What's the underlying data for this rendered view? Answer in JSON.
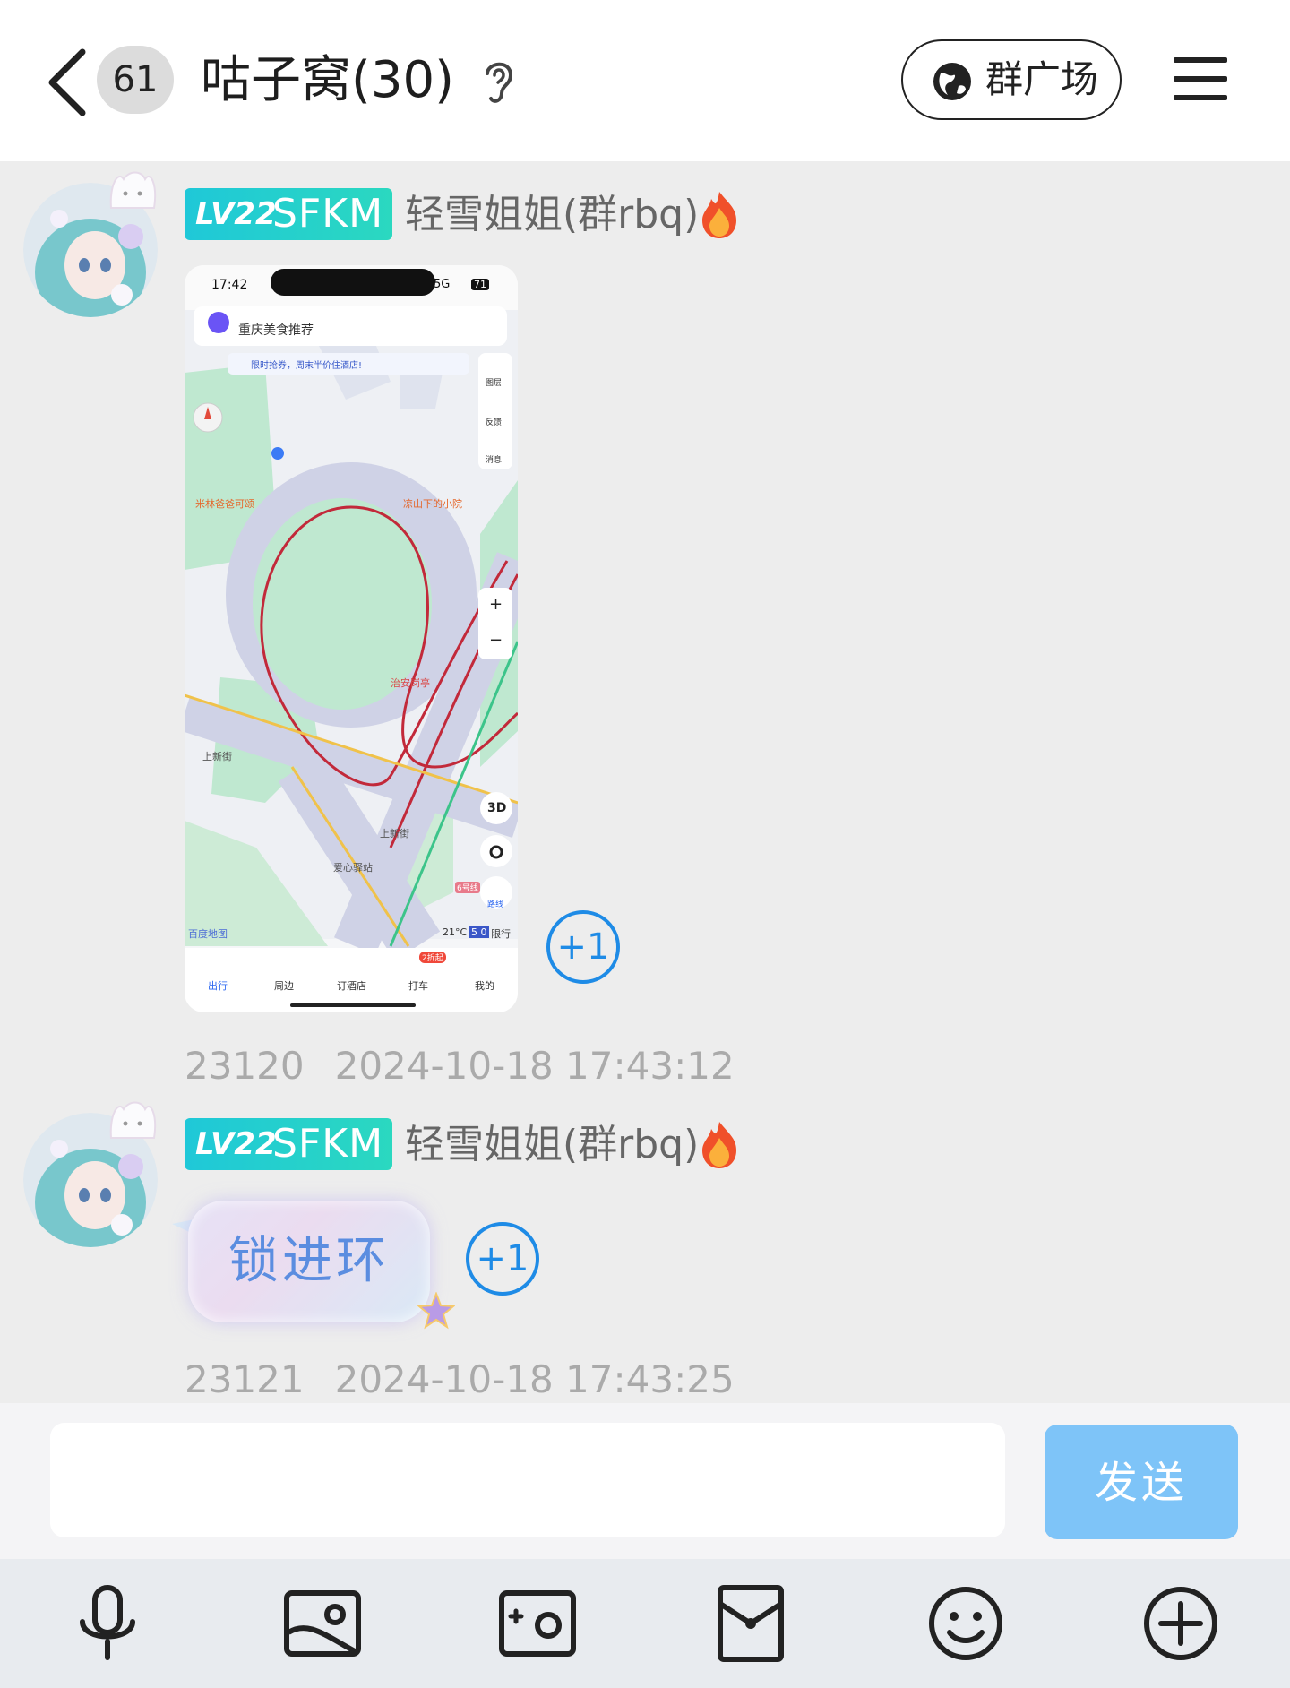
{
  "header": {
    "unread_count": "61",
    "title": "咕子窝(30)",
    "square_label": "群广场"
  },
  "messages": [
    {
      "level": "LV22",
      "badge": "SFKM",
      "sender": "轻雪姐姐(群rbq)",
      "plus_one": "+1",
      "msg_id": "23120",
      "time": "2024-10-18 17:43:12"
    },
    {
      "level": "LV22",
      "badge": "SFKM",
      "sender": "轻雪姐姐(群rbq)",
      "text": "锁进环",
      "plus_one": "+1",
      "msg_id": "23121",
      "time": "2024-10-18 17:43:25"
    }
  ],
  "screenshot": {
    "status_time": "17:42",
    "network": "5G",
    "battery": "71",
    "search_text": "重庆美食推荐",
    "promo_text": "限时抢券，周末半价住酒店!",
    "side_tools": [
      "图层",
      "反馈",
      "消息"
    ],
    "zoom_in": "+",
    "zoom_out": "−",
    "poi_1": "米林爸爸可颂",
    "poi_2": "凉山下的小院",
    "poi_3": "治安岗亭",
    "poi_4": "爱心驿站",
    "street_1": "上新街",
    "street_2": "上新街",
    "badge_3d": "3D",
    "route_label": "路线",
    "road_tag": "6号线",
    "weather": "21°C",
    "limit_num": "5 0",
    "limit_label": "限行",
    "map_brand": "百度地图",
    "taxi_badge": "2折起",
    "nav_tabs": [
      "出行",
      "周边",
      "订酒店",
      "打车",
      "我的"
    ]
  },
  "input": {
    "placeholder": "",
    "send_label": "发送"
  },
  "toolbar_icons": [
    "microphone-icon",
    "image-icon",
    "camera-icon",
    "red-packet-icon",
    "emoji-icon",
    "plus-icon"
  ],
  "colors": {
    "accent_blue": "#1e8be6",
    "send_button": "#7ec4f8",
    "level_badge": "#1fc8d8",
    "bubble_text": "#5b8de0"
  }
}
